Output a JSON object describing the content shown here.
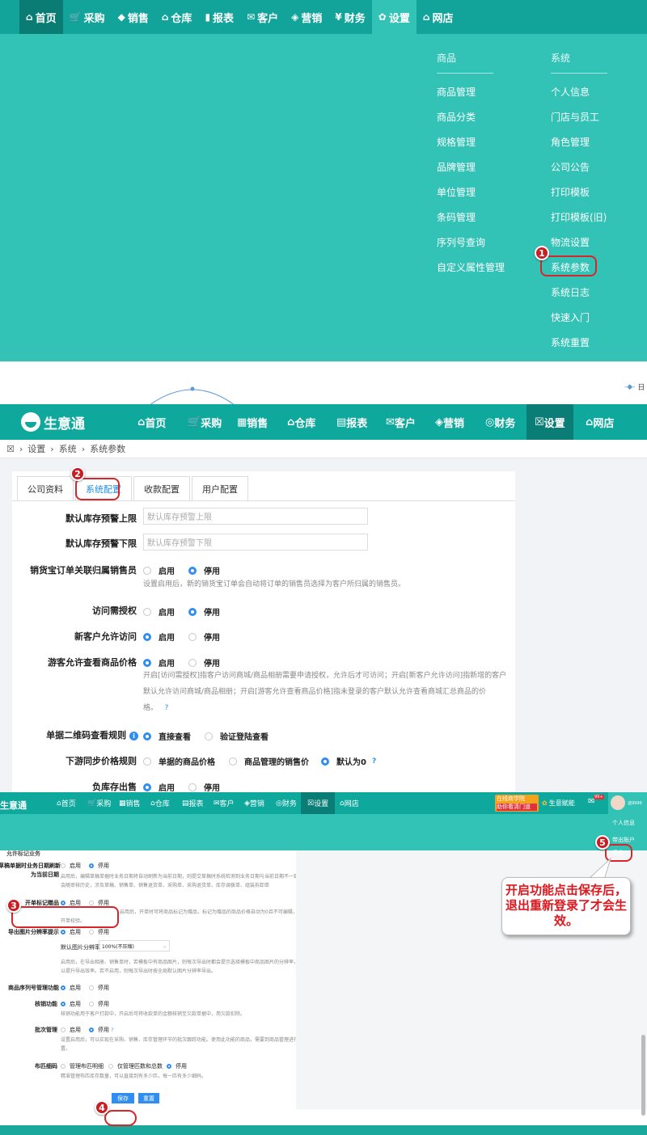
{
  "panel1": {
    "nav": [
      {
        "icon": "⌂",
        "label": "首页"
      },
      {
        "icon": "🛒",
        "label": "采购"
      },
      {
        "icon": "◆",
        "label": "销售"
      },
      {
        "icon": "⌂",
        "label": "仓库"
      },
      {
        "icon": "▮",
        "label": "报表"
      },
      {
        "icon": "✉",
        "label": "客户"
      },
      {
        "icon": "◈",
        "label": "营销"
      },
      {
        "icon": "¥",
        "label": "财务"
      },
      {
        "icon": "✿",
        "label": "设置"
      },
      {
        "icon": "⌂",
        "label": "网店"
      }
    ],
    "goods_header": "商品",
    "goods_items": [
      "商品管理",
      "商品分类",
      "规格管理",
      "品牌管理",
      "单位管理",
      "条码管理",
      "序列号查询",
      "自定义属性管理"
    ],
    "system_header": "系统",
    "system_items": [
      "个人信息",
      "门店与员工",
      "角色管理",
      "公司公告",
      "打印模板",
      "打印模板(旧)",
      "物流设置",
      "系统参数",
      "系统日志",
      "快速入门",
      "系统重置"
    ],
    "badge": "1",
    "strip_text": "日"
  },
  "panel2": {
    "logo": "生意通",
    "nav": [
      {
        "icon": "⌂",
        "label": "首页"
      },
      {
        "icon": "🛒",
        "label": "采购"
      },
      {
        "icon": "▦",
        "label": "销售"
      },
      {
        "icon": "⌂",
        "label": "仓库"
      },
      {
        "icon": "▤",
        "label": "报表"
      },
      {
        "icon": "✉",
        "label": "客户"
      },
      {
        "icon": "◈",
        "label": "营销"
      },
      {
        "icon": "◎",
        "label": "财务"
      },
      {
        "icon": "☒",
        "label": "设置"
      },
      {
        "icon": "⌂",
        "label": "网店"
      }
    ],
    "breadcrumb": [
      "设置",
      "系统",
      "系统参数"
    ],
    "tabs": [
      "公司资料",
      "系统配置",
      "收款配置",
      "用户配置"
    ],
    "badge": "2",
    "rows": {
      "stock_upper_label": "默认库存预警上限",
      "stock_upper_placeholder": "默认库存预警上限",
      "stock_lower_label": "默认库存预警下限",
      "stock_lower_placeholder": "默认库存预警下限",
      "order_label": "销货宝订单关联归属销售员",
      "order_opts": [
        "启用",
        "停用"
      ],
      "order_hint": "设置启用后，新的销货宝订单会自动将订单的销售员选择为客户所归属的销售员。",
      "auth_label": "访问需授权",
      "auth_opts": [
        "启用",
        "停用"
      ],
      "newcust_label": "新客户允许访问",
      "newcust_opts": [
        "启用",
        "停用"
      ],
      "guest_label": "游客允许查看商品价格",
      "guest_opts": [
        "启用",
        "停用"
      ],
      "guest_hint1": "开启[访问需授权]指客户访问商城/商品相册需要申请授权，允许后才可访问；开启[新客户允许访问]指新增的客户",
      "guest_hint2": "默认允许访问商城/商品相册；开启[游客允许查看商品价格]指未登录的客户默认允许查看商城汇总商品的价",
      "guest_hint3": "格。",
      "qr_label": "单据二维码查看规则",
      "qr_opts": [
        "直接查看",
        "验证登陆查看"
      ],
      "price_label": "下游同步价格规则",
      "price_opts": [
        "单据的商品价格",
        "商品管理的销售价",
        "默认为0"
      ],
      "neg_label": "负库存出售",
      "neg_opts": [
        "启用",
        "停用"
      ]
    }
  },
  "panel3": {
    "logo": "生意通",
    "nav": [
      {
        "icon": "⌂",
        "label": "首页"
      },
      {
        "icon": "🛒",
        "label": "采购"
      },
      {
        "icon": "▦",
        "label": "销售"
      },
      {
        "icon": "⌂",
        "label": "仓库"
      },
      {
        "icon": "▤",
        "label": "报表"
      },
      {
        "icon": "✉",
        "label": "客户"
      },
      {
        "icon": "◈",
        "label": "营销"
      },
      {
        "icon": "◎",
        "label": "财务"
      },
      {
        "icon": "☒",
        "label": "设置"
      },
      {
        "icon": "⌂",
        "label": "网店"
      }
    ],
    "promo": "在线商学院",
    "promo_sub": "助你看清门道",
    "brand": "生意赋能",
    "mail_count": "99+",
    "user": "迪9999",
    "user_menu": [
      "个人信息",
      "带出账户",
      "退出"
    ],
    "rows": {
      "partial_top": "允许标记业务",
      "date_label": "草稿单据时业务日期刷新",
      "date_label2": "为当前日期",
      "date_opts": [
        "启用",
        "停用"
      ],
      "date_hint1": "启用后，编辑草稿单据时业务日期将自动刷新为当前日期，则提交草稿时系统检测到业务日期与当前日期不一致，则",
      "date_hint2": "会随审核历史，涉及草稿、销售单、销售退货单、采购单、采购退货单、库存调拨单、组装拆卸单",
      "mark_label": "开单标记赠品",
      "mark_opts": [
        "启用",
        "停用"
      ],
      "mark_hint1": "启用后，开单时可将商品标记为赠品，标记为赠品的商品价格自动为0且不可编辑，同时不参与最低销售价的",
      "mark_hint2": "开单校验。",
      "img_label": "导出图片分辨率提示",
      "img_opts": [
        "启用",
        "停用"
      ],
      "img_sub": "默认图片分辨率",
      "img_value": "100%(不压缩)",
      "img_hint1": "启用后，在导出相册、销售单时，若模板中有商品图片，则每次导出时都会提示选择模板中商品图片的分辨率，",
      "img_hint2": "以提升导出效率。若不启用，则每次导出时按全局默认图片分辨率导出。",
      "serial_label": "商品序列号管理功能",
      "serial_opts": [
        "启用",
        "停用"
      ],
      "verify_label": "核销功能",
      "verify_opts": [
        "启用",
        "停用"
      ],
      "verify_hint": "核销功能用于客户打款中，开启后可将收款单的金额核销至欠款单据中，用欠款扣除。",
      "batch_label": "批次管理",
      "batch_opts": [
        "启用",
        "停用"
      ],
      "batch_hint1": "设置启用后，可以实现在采购、销售、库存管理环节的批次跟踪功能。使用此功能的商品，需要到商品管理进行配",
      "batch_hint2": "置。",
      "yard_label": "布匹细码",
      "yard_opts": [
        "管理布匹明细",
        "仅管理匹数和总数",
        "停用"
      ],
      "yard_hint": "精准管理布匹库存数量，可以直接到有多少匹，每一匹有多少细码。",
      "save": "保存",
      "reset": "重置"
    },
    "callout": "开启功能点击保存后，退出重新登录了才会生效。",
    "badges": [
      "3",
      "4",
      "5"
    ]
  },
  "colors": {
    "nav_teal": "#12a49a",
    "menu_teal": "#33c2b6",
    "active_dark": "#0a7c74",
    "annotation_red": "#d6262c",
    "radio_blue": "#2f8ef0"
  }
}
